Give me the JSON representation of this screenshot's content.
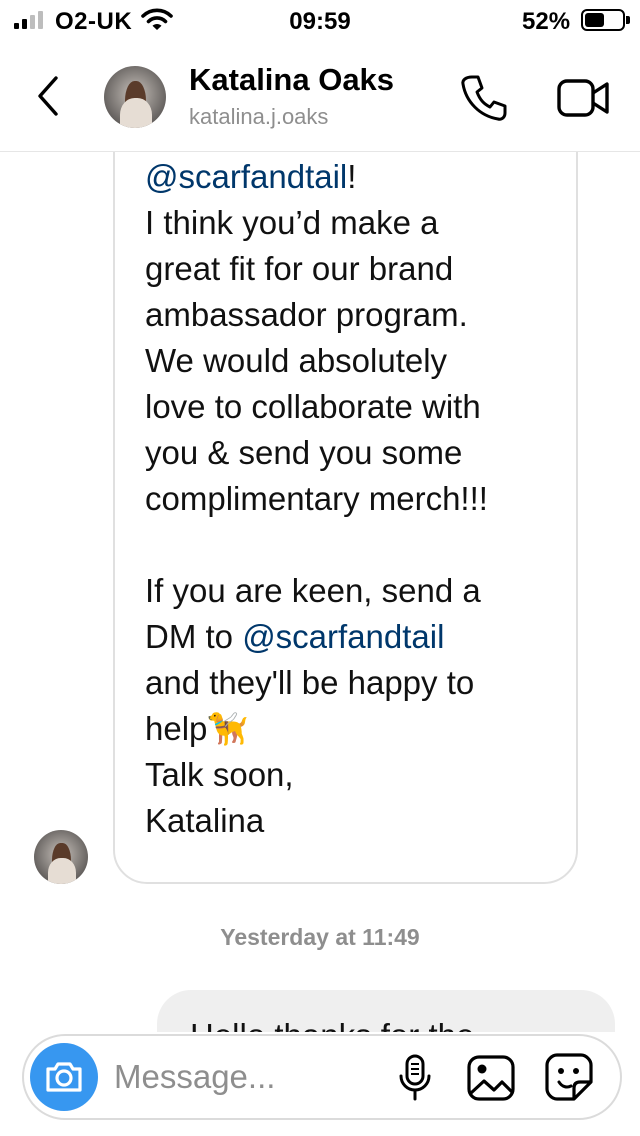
{
  "status_bar": {
    "carrier": "O2-UK",
    "time": "09:59",
    "battery_percent": "52%",
    "battery_level": 0.52,
    "signal_bars_on": 2,
    "signal_bars_total": 4,
    "icons": [
      "signal-icon",
      "wifi-icon",
      "battery-icon"
    ]
  },
  "header": {
    "contact_name": "Katalina Oaks",
    "contact_handle": "katalina.j.oaks",
    "icons": [
      "back-chevron-icon",
      "avatar",
      "phone-icon",
      "video-camera-icon"
    ]
  },
  "chat": {
    "incoming_message": {
      "parts": [
        {
          "type": "mention",
          "text": "@scarfandtail"
        },
        {
          "type": "text",
          "text": "!\nI think you’d make a\ngreat fit for our brand\nambassador program.\nWe would absolutely\nlove to collaborate with\nyou & send you some\ncomplimentary merch!!!\n\nIf you are keen, send a\nDM to "
        },
        {
          "type": "mention",
          "text": "@scarfandtail"
        },
        {
          "type": "text",
          "text": "\nand they'll be happy to\nhelp🦮\nTalk soon,\nKatalina"
        }
      ]
    },
    "timestamp": "Yesterday at 11:49",
    "outgoing_message_partial": "Hello thanks for the"
  },
  "composer": {
    "placeholder": "Message...",
    "icons": [
      "camera-icon",
      "microphone-icon",
      "gallery-icon",
      "sticker-icon"
    ]
  },
  "colors": {
    "mention": "#00376b",
    "camera_button": "#3797f0",
    "muted_text": "#8e8e8e",
    "outgoing_bubble": "#efefef"
  }
}
